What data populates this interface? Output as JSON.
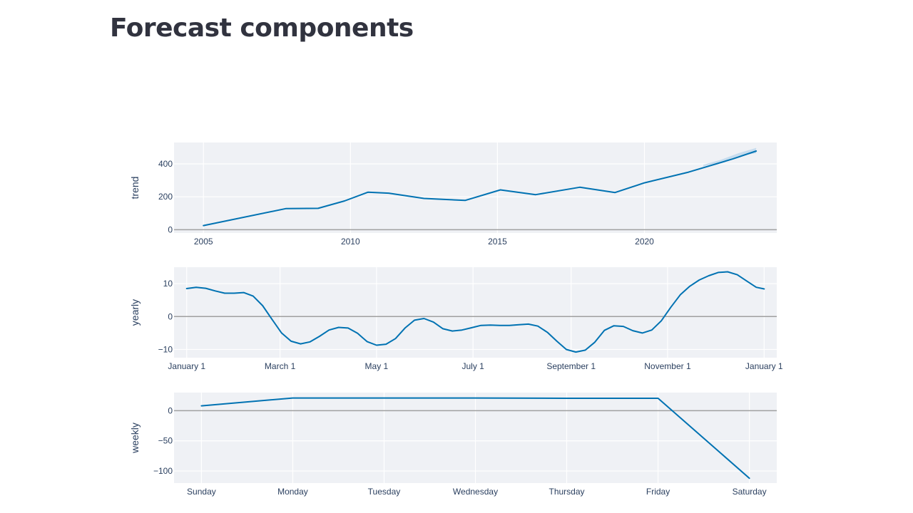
{
  "page": {
    "title": "Forecast components"
  },
  "colors": {
    "line": "#0072b2",
    "band": "#bcd7ec",
    "plot_bg": "#eff1f5",
    "grid": "#ffffff",
    "zeroline": "#a0a0a0",
    "text": "#2a3f5f"
  },
  "chart_data": [
    {
      "type": "line",
      "ylabel": "trend",
      "xlabel": "",
      "xlim": [
        2004.0,
        2024.5
      ],
      "ylim": [
        -20,
        530
      ],
      "x_ticks": [
        {
          "value": 2005,
          "label": "2005"
        },
        {
          "value": 2010,
          "label": "2010"
        },
        {
          "value": 2015,
          "label": "2015"
        },
        {
          "value": 2020,
          "label": "2020"
        }
      ],
      "y_ticks": [
        {
          "value": 0,
          "label": "0"
        },
        {
          "value": 200,
          "label": "200"
        },
        {
          "value": 400,
          "label": "400"
        }
      ],
      "grid": true,
      "series": [
        {
          "x": [
            2005.0,
            2007.8,
            2008.9,
            2009.8,
            2010.6,
            2011.3,
            2012.5,
            2013.9,
            2015.1,
            2016.3,
            2017.8,
            2019.0,
            2020.0,
            2021.5,
            2023.0,
            2023.8
          ],
          "y": [
            25,
            128,
            130,
            175,
            228,
            222,
            190,
            178,
            242,
            213,
            258,
            226,
            285,
            350,
            430,
            478
          ]
        }
      ],
      "uncertainty": {
        "x": [
          2022.0,
          2022.6,
          2023.2,
          2023.8
        ],
        "lower": [
          385,
          410,
          448,
          465
        ],
        "upper": [
          395,
          425,
          465,
          497
        ]
      }
    },
    {
      "type": "line",
      "ylabel": "yearly",
      "xlabel": "",
      "xlim": [
        -8,
        373
      ],
      "ylim": [
        -12.5,
        15
      ],
      "x_ticks": [
        {
          "value": 0,
          "label": "January 1"
        },
        {
          "value": 59,
          "label": "March 1"
        },
        {
          "value": 120,
          "label": "May 1"
        },
        {
          "value": 181,
          "label": "July 1"
        },
        {
          "value": 243,
          "label": "September 1"
        },
        {
          "value": 304,
          "label": "November 1"
        },
        {
          "value": 365,
          "label": "January 1"
        }
      ],
      "y_ticks": [
        {
          "value": -10,
          "label": "−10"
        },
        {
          "value": 0,
          "label": "0"
        },
        {
          "value": 10,
          "label": "10"
        }
      ],
      "grid": true,
      "series": [
        {
          "x": [
            0,
            6,
            12,
            18,
            24,
            30,
            36,
            42,
            48,
            54,
            60,
            66,
            72,
            78,
            84,
            90,
            96,
            102,
            108,
            114,
            120,
            126,
            132,
            138,
            144,
            150,
            156,
            162,
            168,
            174,
            180,
            186,
            192,
            198,
            204,
            210,
            216,
            222,
            228,
            234,
            240,
            246,
            252,
            258,
            264,
            270,
            276,
            282,
            288,
            294,
            300,
            306,
            312,
            318,
            324,
            330,
            336,
            342,
            348,
            354,
            360,
            365
          ],
          "y": [
            8.5,
            8.9,
            8.6,
            7.8,
            7.1,
            7.1,
            7.3,
            6.2,
            3.3,
            -0.9,
            -5.0,
            -7.5,
            -8.3,
            -7.7,
            -6.0,
            -4.1,
            -3.3,
            -3.5,
            -5.1,
            -7.6,
            -8.7,
            -8.4,
            -6.7,
            -3.5,
            -1.1,
            -0.6,
            -1.7,
            -3.7,
            -4.4,
            -4.1,
            -3.4,
            -2.7,
            -2.6,
            -2.7,
            -2.7,
            -2.5,
            -2.3,
            -2.9,
            -4.8,
            -7.5,
            -10.0,
            -10.8,
            -10.2,
            -7.8,
            -4.2,
            -2.8,
            -3.0,
            -4.3,
            -5.0,
            -4.1,
            -1.3,
            2.8,
            6.6,
            9.2,
            11.1,
            12.4,
            13.4,
            13.6,
            12.7,
            10.8,
            8.9,
            8.4
          ]
        }
      ]
    },
    {
      "type": "line",
      "ylabel": "weekly",
      "xlabel": "",
      "xlim": [
        -0.3,
        6.3
      ],
      "ylim": [
        -120,
        30
      ],
      "x_ticks": [
        {
          "value": 0,
          "label": "Sunday"
        },
        {
          "value": 1,
          "label": "Monday"
        },
        {
          "value": 2,
          "label": "Tuesday"
        },
        {
          "value": 3,
          "label": "Wednesday"
        },
        {
          "value": 4,
          "label": "Thursday"
        },
        {
          "value": 5,
          "label": "Friday"
        },
        {
          "value": 6,
          "label": "Saturday"
        }
      ],
      "y_ticks": [
        {
          "value": -100,
          "label": "−100"
        },
        {
          "value": -50,
          "label": "−50"
        },
        {
          "value": 0,
          "label": "0"
        }
      ],
      "grid": true,
      "series": [
        {
          "x": [
            0,
            1,
            2,
            3,
            4,
            5,
            6
          ],
          "y": [
            8,
            21,
            21,
            21,
            20.5,
            20.5,
            -112
          ]
        }
      ]
    }
  ]
}
